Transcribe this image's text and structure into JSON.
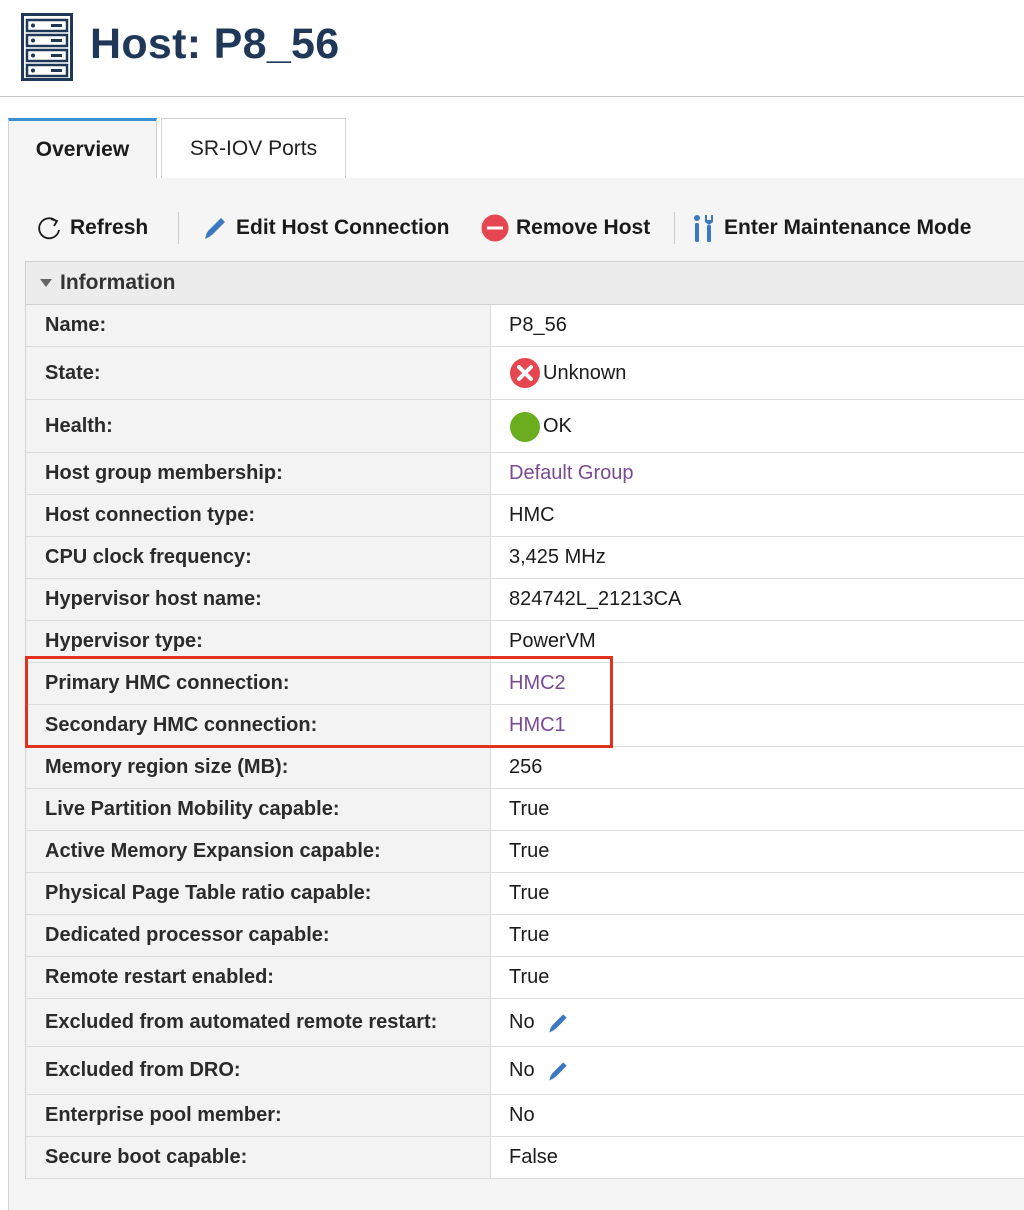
{
  "header": {
    "title": "Host: P8_56",
    "icon": "server-rack-icon"
  },
  "tabs": [
    {
      "label": "Overview",
      "active": true
    },
    {
      "label": "SR-IOV Ports",
      "active": false
    }
  ],
  "toolbar": {
    "refresh": {
      "label": "Refresh",
      "icon": "refresh-icon"
    },
    "edit": {
      "label": "Edit Host Connection",
      "icon": "pencil-icon"
    },
    "remove": {
      "label": "Remove Host",
      "icon": "remove-circle-icon"
    },
    "maintenance": {
      "label": "Enter Maintenance Mode",
      "icon": "tools-icon"
    }
  },
  "section": {
    "title": "Information",
    "expanded": true
  },
  "rows": [
    {
      "label": "Name:",
      "value": "P8_56"
    },
    {
      "label": "State:",
      "value": "Unknown",
      "status": "error"
    },
    {
      "label": "Health:",
      "value": "OK",
      "status": "ok"
    },
    {
      "label": "Host group membership:",
      "value": "Default Group",
      "link": true
    },
    {
      "label": "Host connection type:",
      "value": "HMC"
    },
    {
      "label": "CPU clock frequency:",
      "value": "3,425 MHz"
    },
    {
      "label": "Hypervisor host name:",
      "value": "824742L_21213CA"
    },
    {
      "label": "Hypervisor type:",
      "value": "PowerVM"
    },
    {
      "label": "Primary HMC connection:",
      "value": "HMC2",
      "link": true
    },
    {
      "label": "Secondary HMC connection:",
      "value": "HMC1",
      "link": true
    },
    {
      "label": "Memory region size (MB):",
      "value": "256"
    },
    {
      "label": "Live Partition Mobility capable:",
      "value": "True"
    },
    {
      "label": "Active Memory Expansion capable:",
      "value": "True"
    },
    {
      "label": "Physical Page Table ratio capable:",
      "value": "True"
    },
    {
      "label": "Dedicated processor capable:",
      "value": "True"
    },
    {
      "label": "Remote restart enabled:",
      "value": "True"
    },
    {
      "label": "Excluded from automated remote restart:",
      "value": "No",
      "editable": true
    },
    {
      "label": "Excluded from DRO:",
      "value": "No",
      "editable": true
    },
    {
      "label": "Enterprise pool member:",
      "value": "No"
    },
    {
      "label": "Secure boot capable:",
      "value": "False"
    }
  ],
  "colors": {
    "title": "#1f3857",
    "link": "#7a4b95",
    "highlight": "#e0321c",
    "error": "#e5464f",
    "ok": "#6aad1f",
    "icon_blue": "#3a78c2"
  }
}
